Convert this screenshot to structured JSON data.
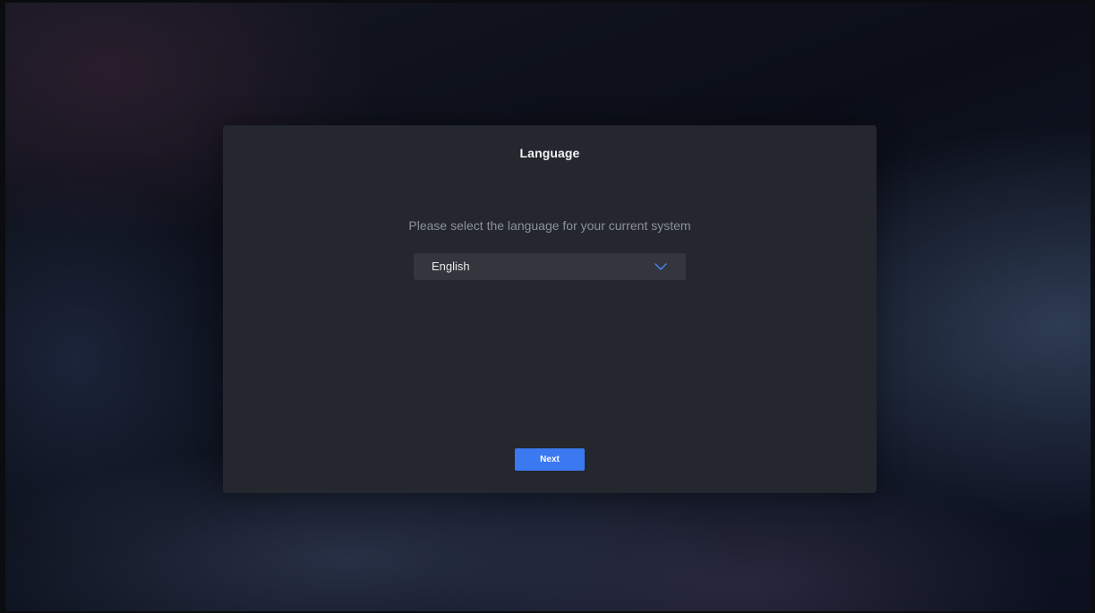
{
  "dialog": {
    "title": "Language",
    "prompt": "Please select the language for your current system",
    "language_select": {
      "selected": "English",
      "icon": "chevron-down-icon"
    },
    "next_label": "Next"
  },
  "colors": {
    "dialog_bg": "#24272e",
    "select_bg": "#33363d",
    "accent": "#3b79f0",
    "chevron": "#4a86f7"
  }
}
